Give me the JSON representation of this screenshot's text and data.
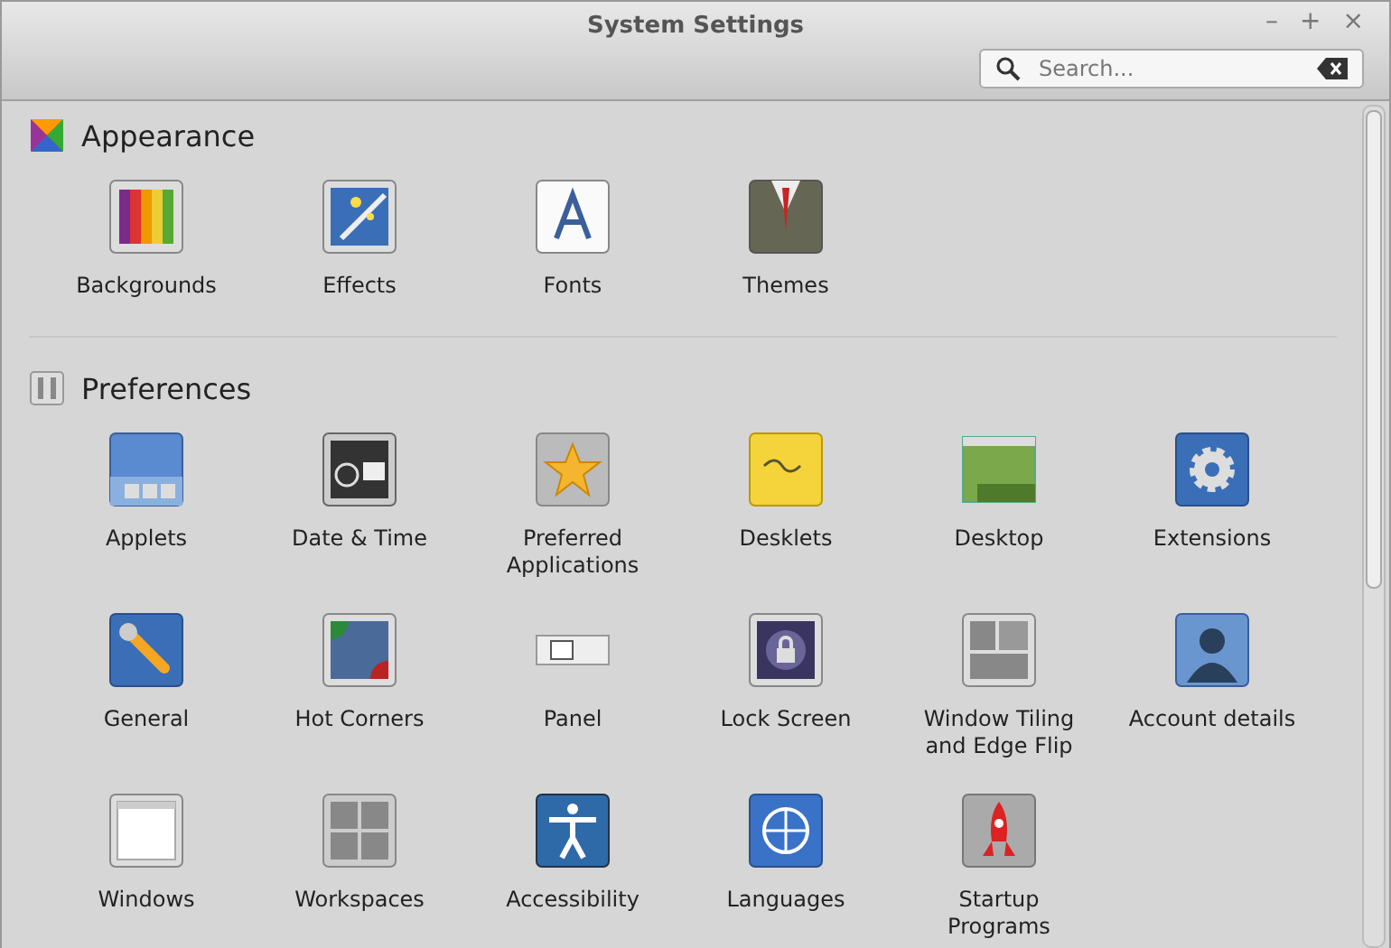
{
  "window": {
    "title": "System Settings",
    "controls": [
      "–",
      "+",
      "×"
    ]
  },
  "search": {
    "placeholder": "Search..."
  },
  "sections": [
    {
      "title": "Appearance",
      "kind": "appearance",
      "items": [
        {
          "label": "Backgrounds",
          "kind": "backgrounds"
        },
        {
          "label": "Effects",
          "kind": "effects"
        },
        {
          "label": "Fonts",
          "kind": "fonts"
        },
        {
          "label": "Themes",
          "kind": "themes"
        }
      ]
    },
    {
      "title": "Preferences",
      "kind": "preferences",
      "items": [
        {
          "label": "Applets",
          "kind": "applets"
        },
        {
          "label": "Date & Time",
          "kind": "datetime"
        },
        {
          "label": "Preferred Applications",
          "kind": "preferred"
        },
        {
          "label": "Desklets",
          "kind": "desklets"
        },
        {
          "label": "Desktop",
          "kind": "desktop"
        },
        {
          "label": "Extensions",
          "kind": "extensions"
        },
        {
          "label": "General",
          "kind": "general"
        },
        {
          "label": "Hot Corners",
          "kind": "hotcorners"
        },
        {
          "label": "Panel",
          "kind": "panel"
        },
        {
          "label": "Lock Screen",
          "kind": "lockscreen"
        },
        {
          "label": "Window Tiling and Edge Flip",
          "kind": "tiling"
        },
        {
          "label": "Account details",
          "kind": "account"
        },
        {
          "label": "Windows",
          "kind": "windows"
        },
        {
          "label": "Workspaces",
          "kind": "workspaces"
        },
        {
          "label": "Accessibility",
          "kind": "accessibility"
        },
        {
          "label": "Languages",
          "kind": "languages"
        },
        {
          "label": "Startup Programs",
          "kind": "startup"
        }
      ]
    }
  ]
}
